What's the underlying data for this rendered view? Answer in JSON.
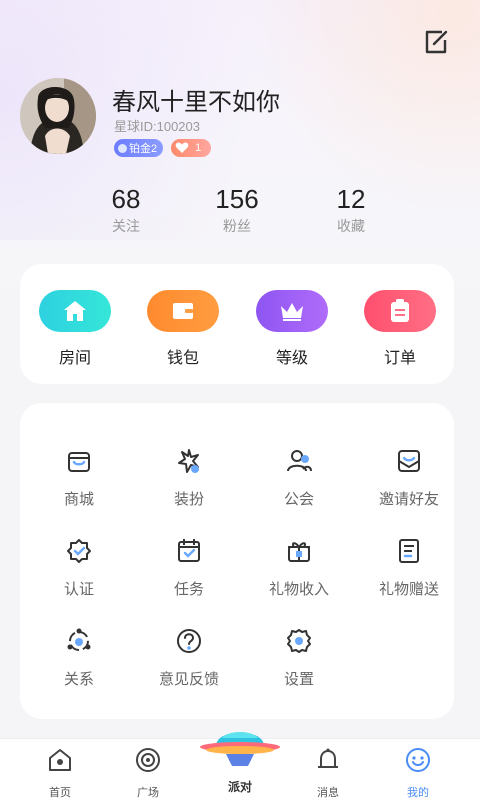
{
  "profile": {
    "nickname": "春风十里不如你",
    "user_id": "星球ID:100203",
    "level_badge": "铂金2",
    "fans_badge_count": "1"
  },
  "stats": [
    {
      "num": "68",
      "label": "关注"
    },
    {
      "num": "156",
      "label": "粉丝"
    },
    {
      "num": "12",
      "label": "收藏"
    }
  ],
  "quick_actions": [
    {
      "label": "房间",
      "icon": "home-icon",
      "color": "#2ed1e0"
    },
    {
      "label": "钱包",
      "icon": "wallet-icon",
      "color": "#ff8a2e"
    },
    {
      "label": "等级",
      "icon": "crown-icon",
      "color": "#9b5cf6"
    },
    {
      "label": "订单",
      "icon": "clipboard-icon",
      "color": "#ff4f6e"
    }
  ],
  "menu": [
    {
      "label": "商城",
      "icon": "shop-icon"
    },
    {
      "label": "装扮",
      "icon": "sparkle-icon"
    },
    {
      "label": "公会",
      "icon": "users-icon"
    },
    {
      "label": "邀请好友",
      "icon": "invite-mail-icon"
    },
    {
      "label": "认证",
      "icon": "verified-badge-icon"
    },
    {
      "label": "任务",
      "icon": "calendar-check-icon"
    },
    {
      "label": "礼物收入",
      "icon": "gift-icon"
    },
    {
      "label": "礼物赠送",
      "icon": "gift-send-doc-icon"
    },
    {
      "label": "关系",
      "icon": "relation-icon"
    },
    {
      "label": "意见反馈",
      "icon": "question-icon"
    },
    {
      "label": "设置",
      "icon": "gear-icon"
    }
  ],
  "tabbar": {
    "home": "首页",
    "plaza": "广场",
    "party": "派对",
    "messages": "消息",
    "mine": "我的"
  },
  "colors": {
    "accent": "#4a8cf7",
    "icon_blue": "#6aa8ff"
  }
}
